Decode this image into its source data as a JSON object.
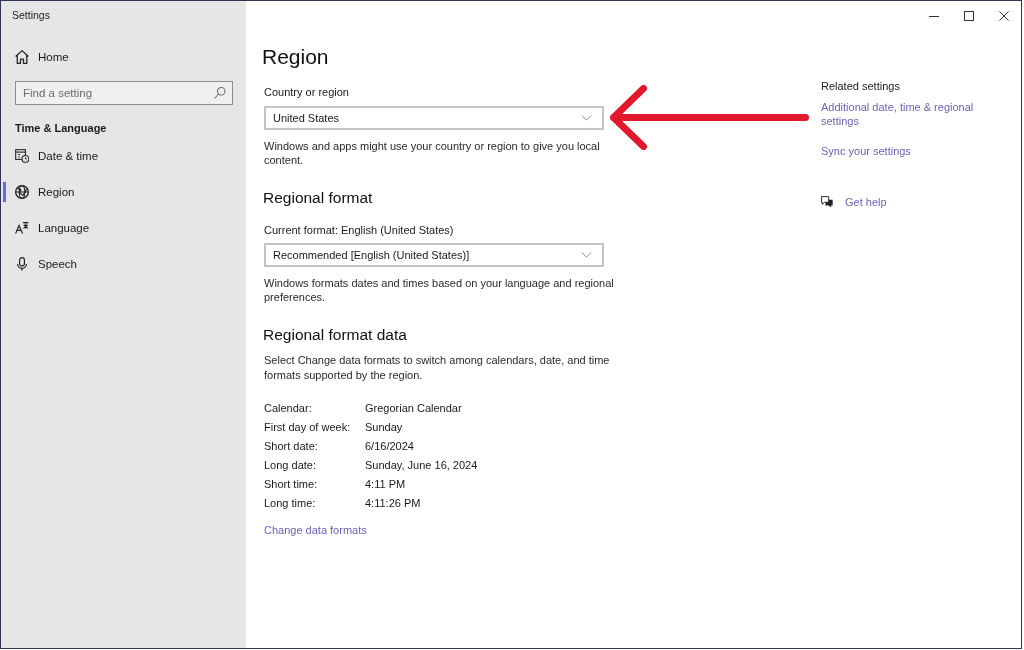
{
  "window": {
    "title": "Settings"
  },
  "sidebar": {
    "home": "Home",
    "search": {
      "placeholder": "Find a setting"
    },
    "section": "Time & Language",
    "items": [
      {
        "label": "Date & time",
        "selected": false
      },
      {
        "label": "Region",
        "selected": true
      },
      {
        "label": "Language",
        "selected": false
      },
      {
        "label": "Speech",
        "selected": false
      }
    ]
  },
  "region": {
    "title": "Region",
    "country_label": "Country or region",
    "country_value": "United States",
    "country_description": "Windows and apps might use your country or region to give you local content."
  },
  "regional_format": {
    "heading": "Regional format",
    "label": "Current format: English (United States)",
    "value": "Recommended [English (United States)]",
    "description": "Windows formats dates and times based on your language and regional preferences."
  },
  "regional_format_data": {
    "heading": "Regional format data",
    "description": "Select Change data formats to switch among calendars, date, and time formats supported by the region.",
    "rows": [
      {
        "label": "Calendar:",
        "value": "Gregorian Calendar"
      },
      {
        "label": "First day of week:",
        "value": "Sunday"
      },
      {
        "label": "Short date:",
        "value": "6/16/2024"
      },
      {
        "label": "Long date:",
        "value": "Sunday, June 16, 2024"
      },
      {
        "label": "Short time:",
        "value": "4:11 PM"
      },
      {
        "label": "Long time:",
        "value": "4:11:26 PM"
      }
    ],
    "link": "Change data formats"
  },
  "related_settings": {
    "heading": "Related settings",
    "links": [
      "Additional date, time & regional settings",
      "Sync your settings"
    ],
    "help": "Get help"
  },
  "annotations": [
    {
      "kind": "arrow"
    }
  ]
}
